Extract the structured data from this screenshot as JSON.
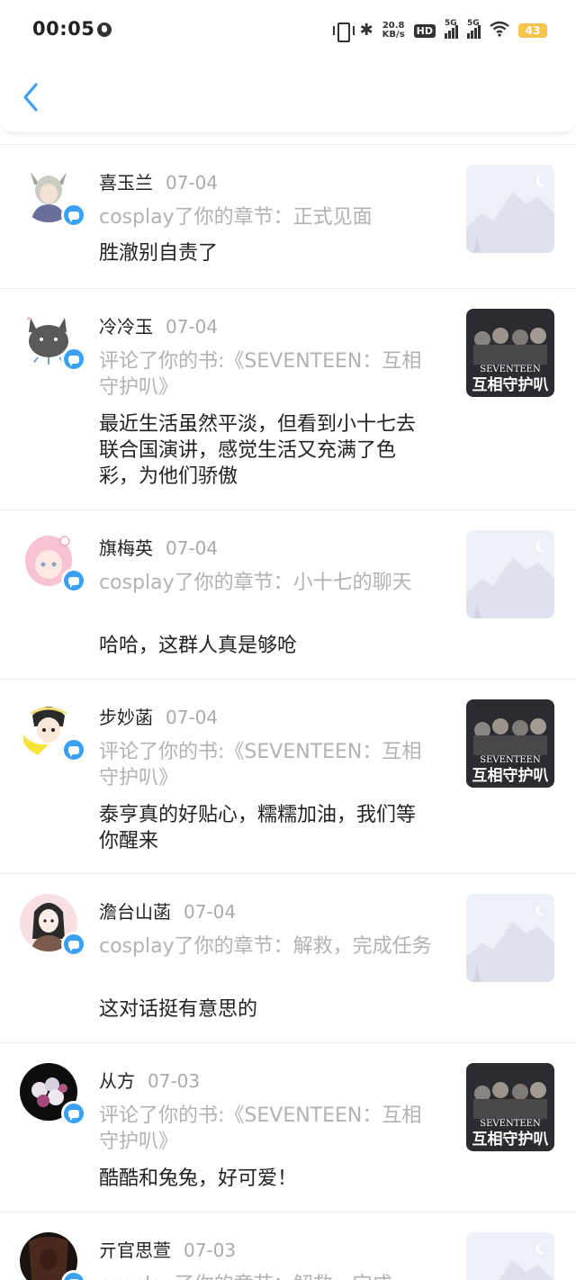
{
  "status_bar": {
    "time": "00:05",
    "net_speed_value": "20.8",
    "net_speed_unit": "KB/s",
    "hd_label": "HD",
    "sim1_label": "5G",
    "sim2_label": "5G",
    "battery": "43"
  },
  "nav": {
    "back_icon": "chevron-left-icon"
  },
  "items": [
    {
      "user": "喜玉兰",
      "date": "07-04",
      "action": "cosplay了你的章节：正式见面",
      "comment": "胜澈别自责了",
      "thumb": "placeholder"
    },
    {
      "user": "冷冷玉",
      "date": "07-04",
      "action": "评论了你的书:《SEVENTEEN：互相守护叭》",
      "comment": "最近生活虽然平淡，但看到小十七去联合国演讲，感觉生活又充满了色彩，为他们骄傲",
      "thumb": "book"
    },
    {
      "user": "旗梅英",
      "date": "07-04",
      "action": "cosplay了你的章节：小十七的聊天",
      "comment": "哈哈，这群人真是够呛",
      "thumb": "placeholder"
    },
    {
      "user": "步妙菡",
      "date": "07-04",
      "action": "评论了你的书:《SEVENTEEN：互相守护叭》",
      "comment": "泰亨真的好贴心，糯糯加油，我们等你醒来",
      "thumb": "book"
    },
    {
      "user": "澹台山菡",
      "date": "07-04",
      "action": "cosplay了你的章节：解救，完成任务",
      "comment": "这对话挺有意思的",
      "thumb": "placeholder"
    },
    {
      "user": "从方",
      "date": "07-03",
      "action": "评论了你的书:《SEVENTEEN：互相守护叭》",
      "comment": "酷酷和兔兔，好可爱！",
      "thumb": "book"
    },
    {
      "user": "亓官思萱",
      "date": "07-03",
      "action": "cosplay了你的章节：解救，完成",
      "comment": "",
      "thumb": "placeholder"
    }
  ],
  "book_cover": {
    "series": "SEVENTEEN",
    "title": "互相守护叭"
  },
  "colors": {
    "accent": "#3aa0f3",
    "battery": "#f6c44a",
    "muted_text": "#b2b2b2"
  }
}
